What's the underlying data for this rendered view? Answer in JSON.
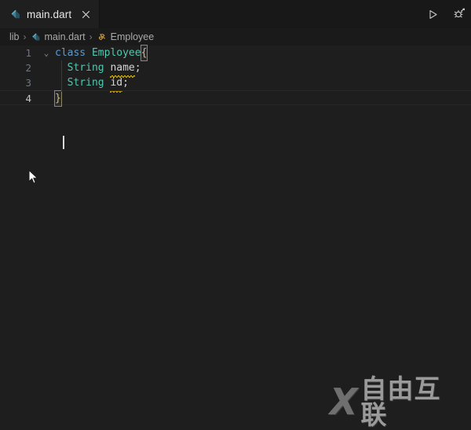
{
  "tab": {
    "label": "main.dart",
    "icon": "dart-file-icon",
    "close_icon": "close-icon"
  },
  "editor_actions": [
    {
      "name": "run-button",
      "icon": "play-icon",
      "tooltip": "Run"
    },
    {
      "name": "debug-button",
      "icon": "debug-icon",
      "tooltip": "Start Debugging"
    }
  ],
  "breadcrumb": {
    "items": [
      {
        "label": "lib",
        "icon": ""
      },
      {
        "label": "main.dart",
        "icon": "dart-file-icon"
      },
      {
        "label": "Employee",
        "icon": "class-symbol-icon"
      }
    ],
    "separator": "›"
  },
  "editor": {
    "language": "dart",
    "fold_chevron": "⌄",
    "lines": [
      {
        "number": "1",
        "active": false,
        "foldable": true,
        "tokens": [
          {
            "text": "class",
            "class": "k-keyword"
          },
          {
            "text": " ",
            "class": "k-punc"
          },
          {
            "text": "Employee",
            "class": "k-type"
          },
          {
            "text": "{",
            "class": "k-brace",
            "bracket_match": true
          }
        ]
      },
      {
        "number": "2",
        "active": false,
        "foldable": false,
        "tokens": [
          {
            "text": "  ",
            "class": "k-punc"
          },
          {
            "text": "String",
            "class": "k-type"
          },
          {
            "text": " ",
            "class": "k-punc"
          },
          {
            "text": "name",
            "class": "k-ident",
            "squiggle": true
          },
          {
            "text": ";",
            "class": "k-punc"
          }
        ]
      },
      {
        "number": "3",
        "active": false,
        "foldable": false,
        "tokens": [
          {
            "text": "  ",
            "class": "k-punc"
          },
          {
            "text": "String",
            "class": "k-type"
          },
          {
            "text": " ",
            "class": "k-punc"
          },
          {
            "text": "id",
            "class": "k-ident",
            "squiggle": true
          },
          {
            "text": ";",
            "class": "k-punc"
          }
        ]
      },
      {
        "number": "4",
        "active": true,
        "foldable": false,
        "tokens": [
          {
            "text": "}",
            "class": "k-brace",
            "bracket_match": true
          }
        ]
      }
    ]
  },
  "watermark": {
    "logo": "X",
    "text": "自由互联"
  },
  "colors": {
    "background": "#1e1e1e",
    "tabbar_background": "#181818",
    "tab_active_background": "#1f1f1f",
    "keyword": "#569cd6",
    "type": "#4ec9b0",
    "identifier": "#d4d4d4",
    "brace": "#d7ba7d",
    "warning_squiggle": "#cca700",
    "line_number": "#6e7681"
  }
}
